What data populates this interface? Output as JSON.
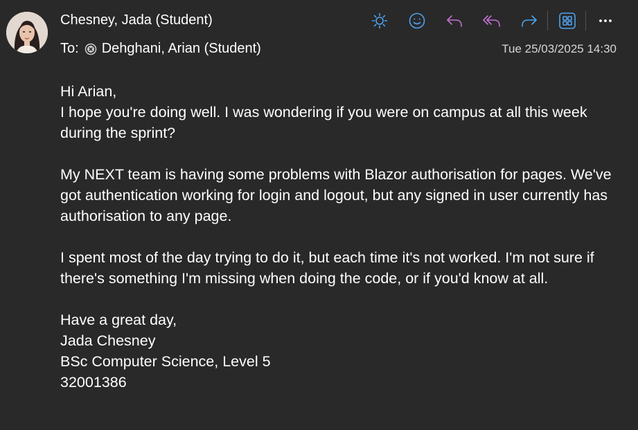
{
  "header": {
    "sender": "Chesney, Jada (Student)",
    "to_label": "To:",
    "recipient": "Dehghani, Arian (Student)",
    "timestamp": "Tue 25/03/2025 14:30"
  },
  "toolbar": {
    "buttons": [
      {
        "icon": "sun-icon",
        "color": "#4ea3f0"
      },
      {
        "icon": "smiley-icon",
        "color": "#4ea3f0"
      },
      {
        "icon": "reply-icon",
        "color": "#c46fd1"
      },
      {
        "icon": "reply-all-icon",
        "color": "#c46fd1"
      },
      {
        "icon": "forward-icon",
        "color": "#4ea3f0"
      },
      {
        "icon": "apps-icon",
        "color": "#4ea3f0"
      },
      {
        "icon": "more-icon",
        "color": "#ffffff"
      }
    ]
  },
  "message": {
    "greeting": "Hi Arian,",
    "para1": "I hope you're doing well. I was wondering if you were on campus at all this week during the sprint?",
    "para2": "My NEXT team is having some problems with Blazor authorisation for pages. We've got authentication working for login and logout, but any signed in user currently has authorisation to any page.",
    "para3": "I spent most of the day trying to do it, but each time it's not worked. I'm not sure if there's something I'm missing when doing the code, or if you'd know at all.",
    "signoff": "Have a great day,",
    "sig_name": "Jada Chesney",
    "sig_course": "BSc Computer Science, Level 5",
    "sig_id": "32001386"
  },
  "colors": {
    "background": "#292929",
    "accent_blue": "#4ea3f0",
    "accent_purple": "#c46fd1"
  }
}
